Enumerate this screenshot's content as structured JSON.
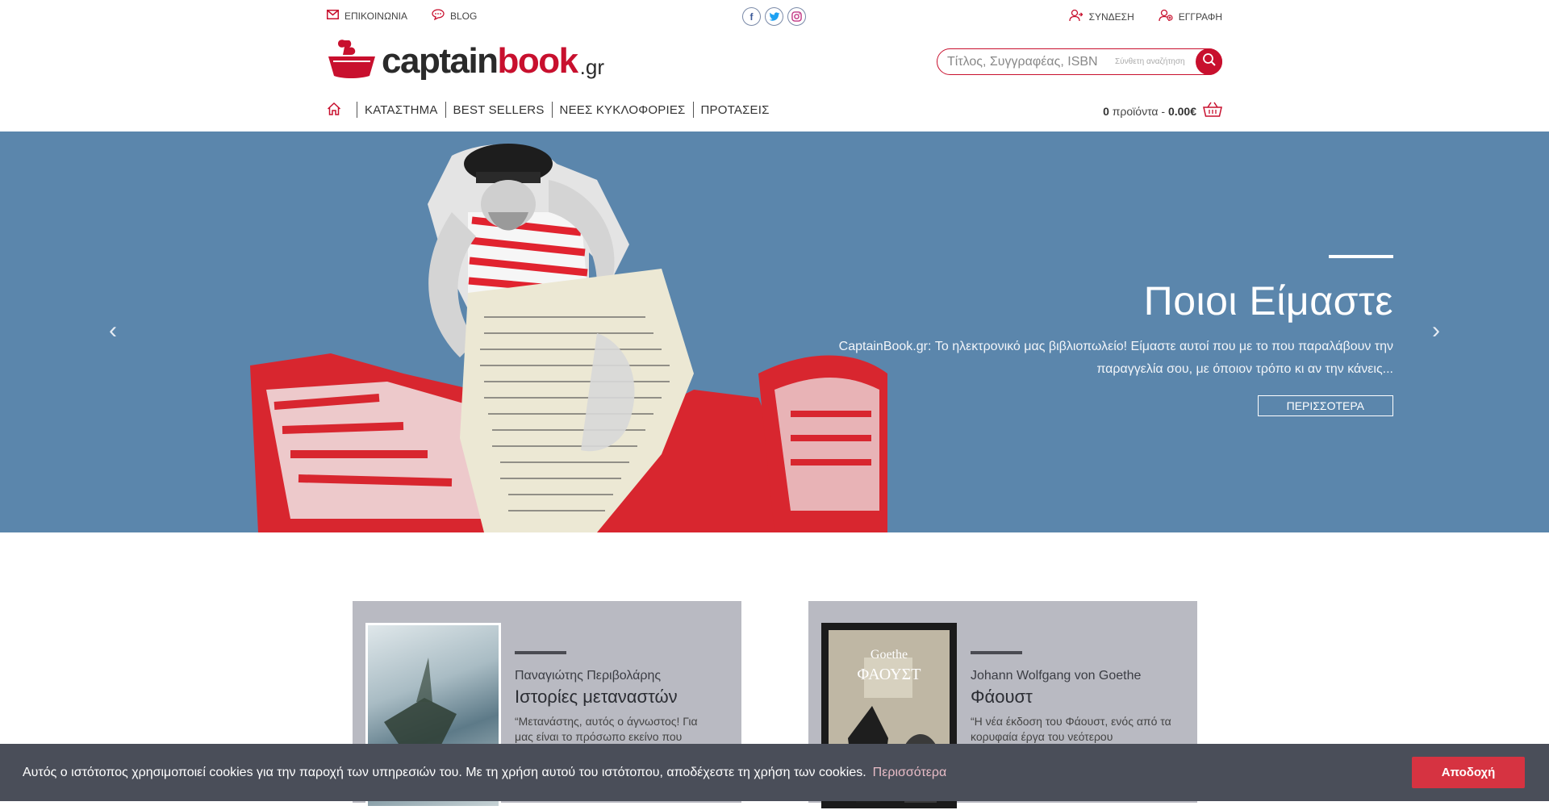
{
  "topbar": {
    "contact_label": "ΕΠΙΚΟΙΝΩΝΙΑ",
    "blog_label": "BLOG",
    "login_label": "ΣΥΝΔΕΣΗ",
    "register_label": "ΕΓΓΡΑΦΗ",
    "social": {
      "facebook": "f",
      "twitter": "t",
      "instagram": "◎"
    }
  },
  "logo": {
    "word_a": "captain",
    "word_b": "book",
    "tld": ".gr"
  },
  "search": {
    "placeholder": "Τίτλος, Συγγραφέας, ISBN",
    "advanced_label": "Σύνθετη αναζήτηση"
  },
  "nav": {
    "items": [
      "ΚΑΤΑΣΤΗΜΑ",
      "BEST SELLERS",
      "ΝΕΕΣ ΚΥΚΛΟΦΟΡΙΕΣ",
      "ΠΡΟΤΑΣΕΙΣ"
    ]
  },
  "cart": {
    "count": "0",
    "count_label": "προϊόντα -",
    "total": "0.00€"
  },
  "hero": {
    "title": "Ποιοι Είμαστε",
    "text": "CaptainBook.gr: Το ηλεκτρονικό μας βιβλιοπωλείο! Είμαστε αυτοί που με το που παραλάβουν την παραγγελία σου, με όποιον τρόπο κι αν την κάνεις...",
    "button_label": "ΠΕΡΙΣΣΟΤΕΡΑ",
    "prev": "‹",
    "next": "›"
  },
  "books": [
    {
      "author": "Παναγιώτης Περιβολάρης",
      "title": "Ιστορίες μεταναστών",
      "quote": "“Μετανάστης, αυτός ο άγνωστος! Για μας είναι το πρόσωπο εκείνο που"
    },
    {
      "author": "Johann Wolfgang von Goethe",
      "title": "Φάουστ",
      "quote": "“Η νέα έκδοση του Φάουστ, ενός από τα κορυφαία έργα του νεότερου",
      "cover_text_a": "Goethe",
      "cover_text_b": "ΦΑΟΥΣΤ"
    }
  ],
  "cookie": {
    "text": "Αυτός ο ιστότοπος χρησιμοποιεί cookies για την παροχή των υπηρεσιών του. Με τη χρήση αυτού του ιστότοπου, αποδέχεστε τη χρήση των cookies.",
    "more_label": "Περισσότερα",
    "accept_label": "Αποδοχή"
  },
  "colors": {
    "brand": "#c8102e",
    "hero_bg": "#5b86ac",
    "card_bg": "#b9bac2",
    "cookie_bg": "#4a4e59",
    "accept": "#d63341"
  }
}
